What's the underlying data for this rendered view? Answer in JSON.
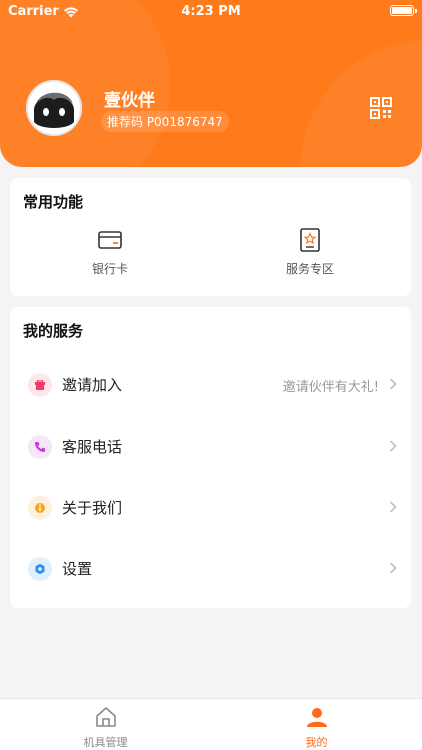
{
  "status_bar": {
    "carrier": "Carrier",
    "time": "4:23 PM"
  },
  "profile": {
    "name": "壹伙伴",
    "referral_code": "推荐码 P001876747"
  },
  "common_functions": {
    "title": "常用功能",
    "items": [
      {
        "label": "银行卡",
        "icon": "bank-card-icon"
      },
      {
        "label": "服务专区",
        "icon": "service-zone-icon"
      }
    ]
  },
  "my_services": {
    "title": "我的服务",
    "items": [
      {
        "label": "邀请加入",
        "hint": "邀请伙伴有大礼!",
        "icon": "invite-icon",
        "color": "#f23c6a"
      },
      {
        "label": "客服电话",
        "hint": "",
        "icon": "phone-icon",
        "color": "#c83ad8"
      },
      {
        "label": "关于我们",
        "hint": "",
        "icon": "info-icon",
        "color": "#f5a623"
      },
      {
        "label": "设置",
        "hint": "",
        "icon": "settings-icon",
        "color": "#2c8ff0"
      }
    ]
  },
  "tabbar": {
    "tabs": [
      {
        "label": "机具管理",
        "icon": "home-icon",
        "active": false
      },
      {
        "label": "我的",
        "icon": "person-icon",
        "active": true
      }
    ]
  },
  "colors": {
    "accent": "#ff7a1a",
    "tab_active": "#ff6a1a",
    "tab_inactive": "#8a8a8a"
  }
}
